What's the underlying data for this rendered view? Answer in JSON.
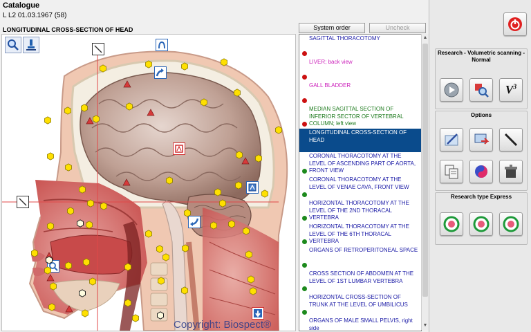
{
  "window": {
    "title": "Catalogue"
  },
  "patient": {
    "info": "L  L2   01.03.1967 (58)"
  },
  "view": {
    "title": "LONGITUDINAL CROSS-SECTION OF HEAD"
  },
  "toolbar": {
    "system_order": "System order",
    "uncheck": "Uncheck"
  },
  "image": {
    "copyright": "Copyright: Biospect®"
  },
  "list": {
    "items": [
      {
        "label": "SAGITTAL THORACOTOMY",
        "color": "#1a1aa6",
        "dot": "#cc1111",
        "selected": false
      },
      {
        "label": "LIVER; back view",
        "color": "#cc22bb",
        "dot": "#cc1111",
        "selected": false
      },
      {
        "label": "GALL BLADDER",
        "color": "#cc22bb",
        "dot": "#cc1111",
        "selected": false
      },
      {
        "label": "MEDIAN SAGITTAL SECTION OF INFERIOR SECTOR OF VERTEBRAL COLUMN; left view",
        "color": "#1d7a1d",
        "dot": "#cc1111",
        "selected": false
      },
      {
        "label": "LONGITUDINAL CROSS-SECTION OF HEAD",
        "color": "#ffffff",
        "dot": "",
        "selected": true
      },
      {
        "label": "CORONAL THORACOTOMY AT THE LEVEL OF ASCENDING PART OF AORTA, FRONT VIEW",
        "color": "#1a1aa6",
        "dot": "#1d8a1d",
        "selected": false
      },
      {
        "label": "CORONAL THORACOTOMY AT THE LEVEL OF VENAE CAVA, FRONT VIEW",
        "color": "#1a1aa6",
        "dot": "#1d8a1d",
        "selected": false
      },
      {
        "label": "HORIZONTAL THORACOTOMY AT THE LEVEL OF THE 2ND THORACAL VERTEBRA",
        "color": "#1a1aa6",
        "dot": "#1d8a1d",
        "selected": false
      },
      {
        "label": "HORIZONTAL THORACOTOMY AT THE LEVEL OF THE 6TH THORACAL VERTEBRA",
        "color": "#1a1aa6",
        "dot": "#1d8a1d",
        "selected": false
      },
      {
        "label": "ORGANS OF RETROPERITONEAL SPACE",
        "color": "#1a1aa6",
        "dot": "#1d8a1d",
        "selected": false
      },
      {
        "label": "CROSS SECTION OF ABDOMEN AT THE LEVEL OF 1ST LUMBAR VERTEBRA",
        "color": "#1a1aa6",
        "dot": "#1d8a1d",
        "selected": false
      },
      {
        "label": "HORIZONTAL CROSS-SECTION OF TRUNK AT THE LEVEL OF UMBILICUS",
        "color": "#1a1aa6",
        "dot": "#1d8a1d",
        "selected": false
      },
      {
        "label": "ORGANS OF MALE SMALL PELVIS, right side",
        "color": "#1a1aa6",
        "dot": "#1d8a1d",
        "selected": false
      }
    ]
  },
  "right": {
    "research_title": "Research - Volumetric scanning - Normal",
    "options_title": "Options",
    "research_type_title": "Research type Express",
    "v3_label": "V",
    "v3_sup": "3"
  },
  "colors": {
    "selection": "#0a4b8c",
    "marker_yellow": "#ffe000",
    "marker_red": "#d63a3a"
  }
}
